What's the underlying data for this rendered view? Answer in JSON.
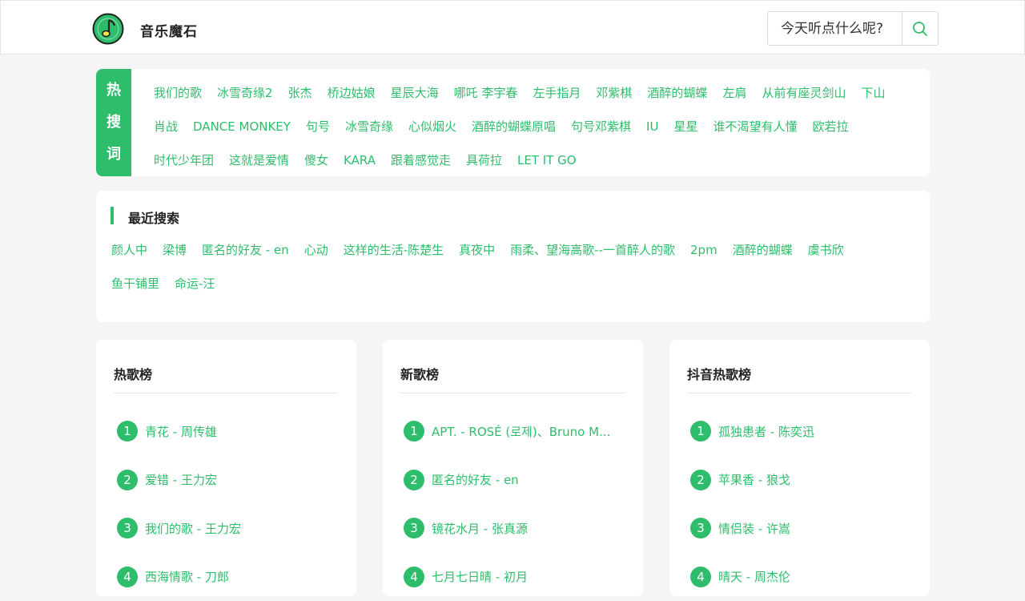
{
  "header": {
    "site_title": "音乐魔石",
    "search_placeholder": "今天听点什么呢?"
  },
  "hot_search": {
    "label": [
      "热",
      "搜",
      "词"
    ],
    "keywords": [
      "我们的歌",
      "冰雪奇缘2",
      "张杰",
      "桥边姑娘",
      "星辰大海",
      "哪吒 李宇春",
      "左手指月",
      "邓紫棋",
      "酒醉的蝴蝶",
      "左肩",
      "从前有座灵剑山",
      "下山",
      "肖战",
      "DANCE MONKEY",
      "句号",
      "冰雪奇缘",
      "心似烟火",
      "酒醉的蝴蝶原唱",
      "句号邓紫棋",
      "IU",
      "星星",
      "谁不渴望有人懂",
      "欧若拉",
      "时代少年团",
      "这就是爱情",
      "傻女",
      "KARA",
      "跟着感觉走",
      "具荷拉",
      "LET IT GO"
    ]
  },
  "recent_search": {
    "title": "最近搜索",
    "keywords": [
      "颜人中",
      "梁博",
      "匿名的好友 - en",
      "心动",
      "这样的生活-陈楚生",
      "真夜中",
      "雨柔、望海高歌--一首醉人的歌",
      "2pm",
      "酒醉的蝴蝶",
      "虞书欣",
      "鱼干铺里",
      "命运-汪"
    ]
  },
  "charts": [
    {
      "title": "热歌榜",
      "items": [
        {
          "rank": "1",
          "text": "青花 - 周传雄"
        },
        {
          "rank": "2",
          "text": "爱错 - 王力宏"
        },
        {
          "rank": "3",
          "text": "我们的歌 - 王力宏"
        },
        {
          "rank": "4",
          "text": "西海情歌 - 刀郎"
        }
      ]
    },
    {
      "title": "新歌榜",
      "items": [
        {
          "rank": "1",
          "text": "APT. - ROSÉ (로제)、Bruno M..."
        },
        {
          "rank": "2",
          "text": "匿名的好友 - en"
        },
        {
          "rank": "3",
          "text": "镜花水月 - 张真源"
        },
        {
          "rank": "4",
          "text": "七月七日晴 - 初月"
        }
      ]
    },
    {
      "title": "抖音热歌榜",
      "items": [
        {
          "rank": "1",
          "text": "孤独患者 - 陈奕迅"
        },
        {
          "rank": "2",
          "text": "苹果香 - 狼戈"
        },
        {
          "rank": "3",
          "text": "情侣装 - 许嵩"
        },
        {
          "rank": "4",
          "text": "晴天 - 周杰伦"
        }
      ]
    }
  ],
  "colors": {
    "accent": "#2ebd6b",
    "background": "#f5f5f5"
  },
  "icons": {
    "logo": "music-note-logo-icon",
    "search": "search-icon"
  }
}
